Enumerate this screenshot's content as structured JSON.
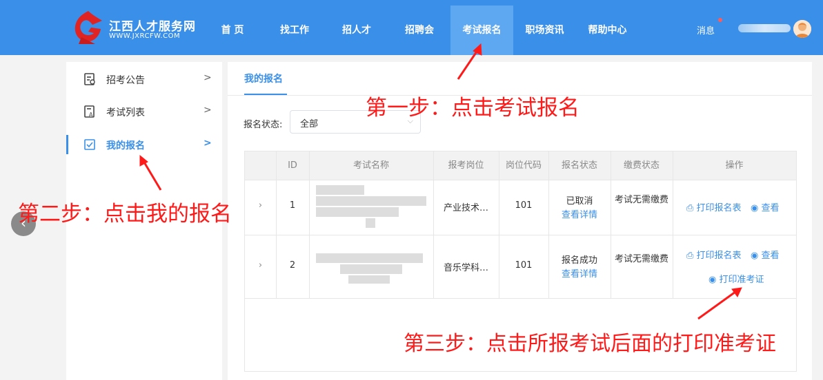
{
  "site": {
    "name_cn": "江西人才服务网",
    "name_en": "WWW.JXRCFW.COM"
  },
  "nav": [
    {
      "label": "首 页"
    },
    {
      "label": "找工作"
    },
    {
      "label": "招人才"
    },
    {
      "label": "招聘会"
    },
    {
      "label": "考试报名"
    },
    {
      "label": "职场资讯"
    },
    {
      "label": "帮助中心"
    }
  ],
  "header": {
    "messages_label": "消息"
  },
  "sidebar": {
    "items": [
      {
        "label": "招考公告"
      },
      {
        "label": "考试列表"
      },
      {
        "label": "我的报名"
      }
    ]
  },
  "main": {
    "tab": "我的报名",
    "filter": {
      "label": "报名状态:",
      "value": "全部"
    },
    "columns": [
      "ID",
      "考试名称",
      "报考岗位",
      "岗位代码",
      "报名状态",
      "缴费状态",
      "操作"
    ],
    "rows": [
      {
        "id": "1",
        "position": "产业技术…",
        "code": "101",
        "status": "已取消",
        "detail": "查看详情",
        "fee": "考试无需缴费",
        "print_form": "打印报名表",
        "view": "查看"
      },
      {
        "id": "2",
        "position": "音乐学科…",
        "code": "101",
        "status": "报名成功",
        "detail": "查看详情",
        "fee": "考试无需缴费",
        "print_form": "打印报名表",
        "view": "查看",
        "print_ticket": "打印准考证"
      }
    ]
  },
  "annotations": {
    "step1": "第一步：点击考试报名",
    "step2": "第二步：点击我的报名",
    "step3": "第三步：点击所报考试后面的打印准考证"
  },
  "colors": {
    "brand": "#3a8fe8",
    "annotation": "#ff1a1a"
  }
}
